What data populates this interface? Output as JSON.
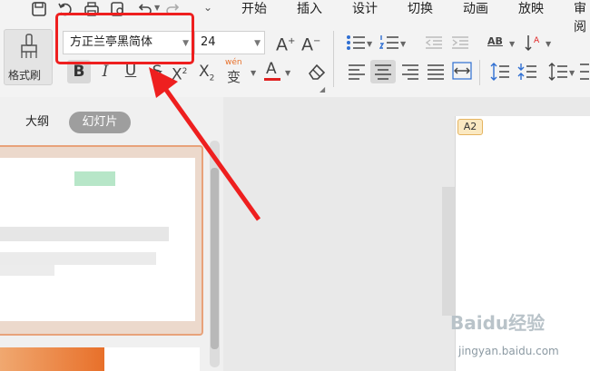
{
  "quick_access": {
    "icons": [
      "save-icon",
      "undo-history-icon",
      "print-icon",
      "print-preview-icon",
      "undo-icon",
      "redo-icon",
      "customize-dropdown-icon"
    ]
  },
  "menu": {
    "items": [
      "开始",
      "插入",
      "设计",
      "切换",
      "动画",
      "放映",
      "审阅"
    ]
  },
  "format_painter": {
    "label": "格式刷"
  },
  "font": {
    "name": "方正兰亭黑简体",
    "size": "24",
    "increase_label": "A",
    "decrease_label": "A"
  },
  "format_buttons": {
    "bold": "B",
    "italic": "I",
    "underline": "U",
    "strike": "S",
    "superscript": "X",
    "subscript": "X",
    "phonetic_top": "wén",
    "phonetic": "变",
    "font_color": "A"
  },
  "paragraph": {
    "ab_label": "AB"
  },
  "panel_tabs": {
    "outline": "大纲",
    "slides": "幻灯片"
  },
  "slide": {
    "tag": "A2"
  },
  "watermark": {
    "text": "Baidu经验",
    "sub": "jingyan.baidu.com"
  },
  "colors": {
    "highlight": "#ee1f1f",
    "accent_orange": "#e8702a",
    "font_color_bar": "#e02020"
  }
}
